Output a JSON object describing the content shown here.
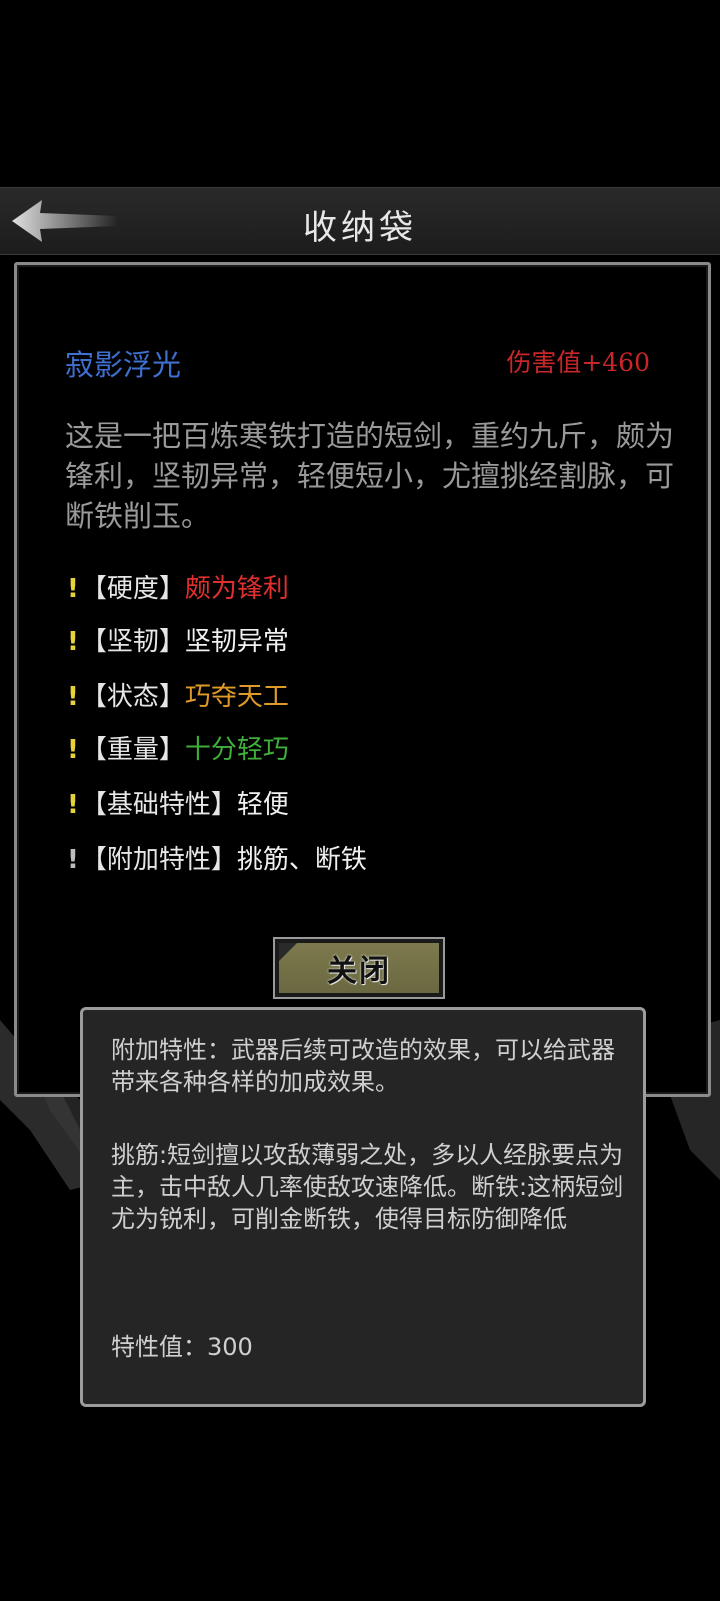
{
  "header": {
    "title": "收纳袋",
    "back_icon": "back-arrow-icon"
  },
  "item": {
    "name": "寂影浮光",
    "damage": "伤害值+460",
    "description": "这是一把百炼寒铁打造的短剑，重约九斤，颇为锋利，坚韧异常，轻便短小，尤擅挑经割脉，可断铁削玉。",
    "attributes": [
      {
        "bang": "!",
        "key": "【硬度】",
        "value": "颇为锋利",
        "value_color": "#e0302e",
        "bang_color": "#e8d23a"
      },
      {
        "bang": "!",
        "key": "【坚韧】",
        "value": "坚韧异常",
        "value_color": "#f0f0f0",
        "bang_color": "#e8d23a"
      },
      {
        "bang": "!",
        "key": "【状态】",
        "value": "巧夺天工",
        "value_color": "#e09a2a",
        "bang_color": "#e8d23a"
      },
      {
        "bang": "!",
        "key": "【重量】",
        "value": "十分轻巧",
        "value_color": "#3fae3a",
        "bang_color": "#e8d23a"
      },
      {
        "bang": "!",
        "key": "【基础特性】",
        "value": "轻便",
        "value_color": "#f0f0f0",
        "bang_color": "#e8d23a"
      },
      {
        "bang": "!",
        "key": "【附加特性】",
        "value": "挑筋、断铁",
        "value_color": "#f0f0f0",
        "bang_color": "#bdbdbd"
      }
    ]
  },
  "close_button": {
    "label": "关闭"
  },
  "tooltip": {
    "intro": "附加特性：武器后续可改造的效果，可以给武器带来各种各样的加成效果。",
    "effects": "挑筋:短剑擅以攻敌薄弱之处，多以人经脉要点为主，击中敌人几率使敌攻速降低。断铁:这柄短剑尤为锐利，可削金断铁，使得目标防御降低",
    "trait_value": "特性值：300"
  }
}
